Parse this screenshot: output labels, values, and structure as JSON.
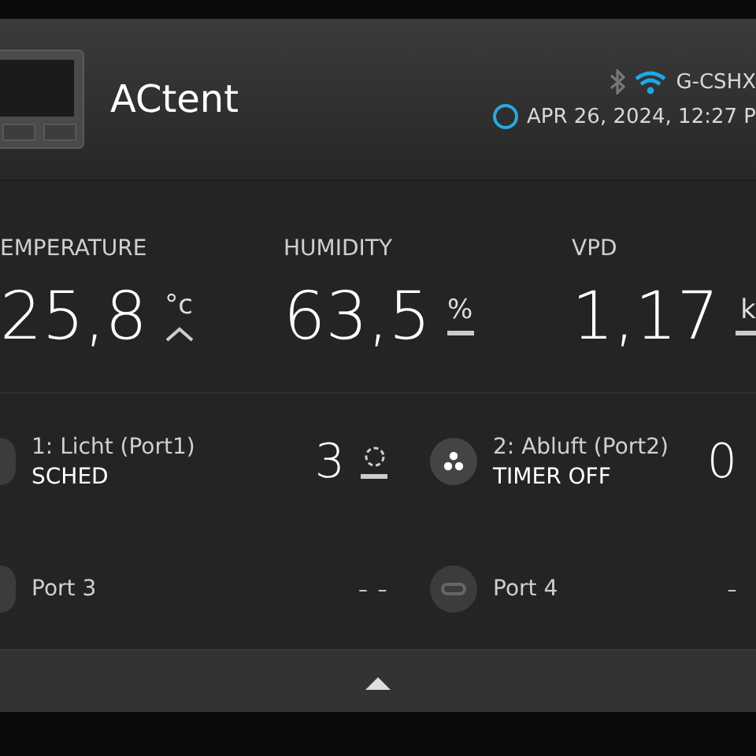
{
  "device": {
    "name": "ACtent",
    "bluetooth_on": false,
    "wifi_on": true,
    "network": "G-CSHX",
    "datetime": "APR 26, 2024, 12:27 P"
  },
  "sensors": [
    {
      "label": "EMPERATURE",
      "value": "25,8",
      "unit": "°c",
      "rising": true
    },
    {
      "label": "HUMIDITY",
      "value": "63,5",
      "unit": "%",
      "rising": false
    },
    {
      "label": "VPD",
      "value": "1,17",
      "unit": "k",
      "rising": false
    }
  ],
  "ports": [
    {
      "kind": "light",
      "name": "1: Licht (Port1)",
      "mode": "SCHED",
      "value": "3",
      "rising": false,
      "waiting": true
    },
    {
      "kind": "fan",
      "name": "2: Abluft (Port2)",
      "mode": "TIMER OFF",
      "value": "0"
    },
    {
      "kind": "empty",
      "name": "Port 3",
      "value": "- -"
    },
    {
      "kind": "empty",
      "name": "Port 4",
      "value": "-"
    }
  ]
}
